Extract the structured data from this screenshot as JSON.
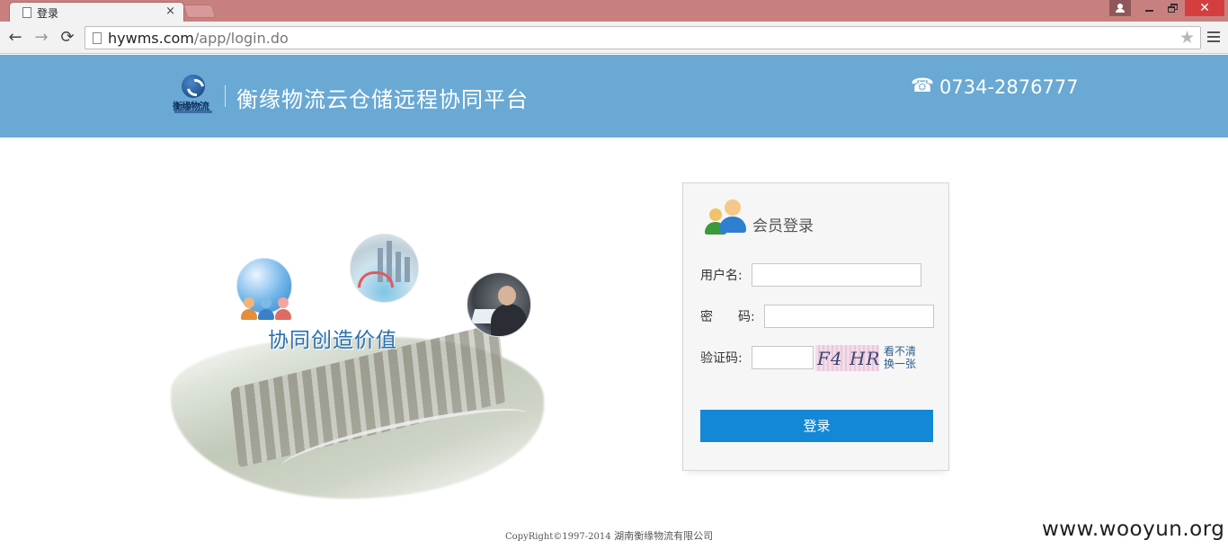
{
  "browser": {
    "tab_title": "登录",
    "tab_close": "×",
    "url_host": "hywms.com",
    "url_path": "/app/login.do",
    "nav_back": "←",
    "nav_forward": "→",
    "nav_reload": "⟳",
    "star": "★",
    "window_close": "✕"
  },
  "header": {
    "logo_text": "衡缘物流",
    "site_title": "衡缘物流云仓储远程协同平台",
    "phone_icon": "☎",
    "phone": "0734-2876777"
  },
  "banner": {
    "slogan": "协同创造价值"
  },
  "login": {
    "title": "会员登录",
    "username_label": "用户名:",
    "password_label": "密　　码:",
    "captcha_label": "验证码:",
    "captcha_code": "F4 HR",
    "refresh_line1": "看不清",
    "refresh_line2": "换一张",
    "submit_label": "登录",
    "username_value": "",
    "password_value": "",
    "captcha_value": ""
  },
  "footer": {
    "copyright_latin": "CopyRight©1997-2014",
    "copyright_company": "湖南衡缘物流有限公司"
  },
  "watermark": "www.wooyun.org",
  "colors": {
    "titlebar": "#c8807f",
    "header_band": "#69a9d4",
    "login_button": "#1388d6",
    "slogan": "#2a6fb0"
  }
}
